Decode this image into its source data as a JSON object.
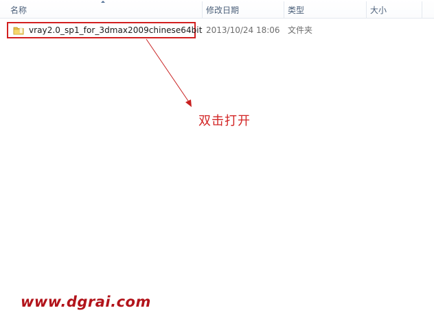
{
  "columns": {
    "name": "名称",
    "date_modified": "修改日期",
    "type": "类型",
    "size": "大小"
  },
  "files": [
    {
      "name": "vray2.0_sp1_for_3dmax2009chinese64bit",
      "date_modified": "2013/10/24 18:06",
      "type": "文件夹",
      "size": "",
      "icon": "folder-icon"
    }
  ],
  "annotation": {
    "text": "双击打开",
    "color": "#d22424"
  },
  "watermark": {
    "text": "www.dgrai.com"
  },
  "colors": {
    "header_text": "#4c607a",
    "highlight_border": "#d21f1f",
    "watermark": "#b2141b"
  }
}
